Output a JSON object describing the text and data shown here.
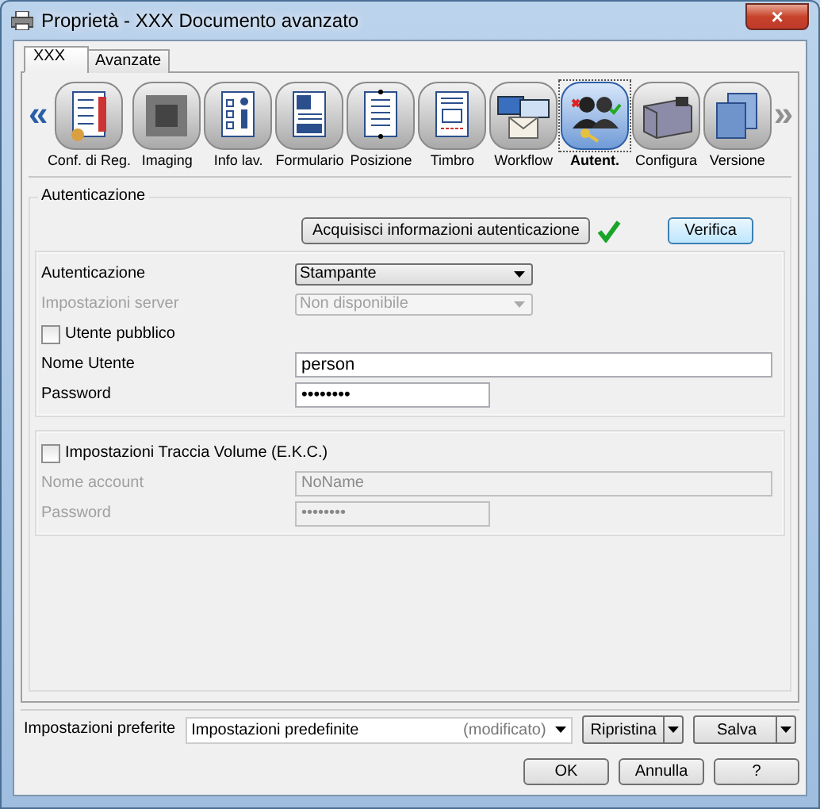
{
  "window": {
    "title": "Proprietà - XXX Documento avanzato",
    "close": "×"
  },
  "tabs": [
    {
      "label": "XXX",
      "selected": true
    },
    {
      "label": "Avanzate",
      "selected": false
    }
  ],
  "scroll_left": {
    "label": "«",
    "disabled": false
  },
  "scroll_right": {
    "label": "»",
    "disabled": true
  },
  "categories": [
    {
      "label": "Conf. di Reg.",
      "kind": "list",
      "selected": false
    },
    {
      "label": "Imaging",
      "kind": "imaging",
      "selected": false
    },
    {
      "label": "Info lav.",
      "kind": "info",
      "selected": false
    },
    {
      "label": "Formulario",
      "kind": "form",
      "selected": false
    },
    {
      "label": "Posizione",
      "kind": "position",
      "selected": false
    },
    {
      "label": "Timbro",
      "kind": "stamp",
      "selected": false
    },
    {
      "label": "Workflow",
      "kind": "workflow",
      "selected": false
    },
    {
      "label": "Autent.",
      "kind": "auth",
      "selected": true
    },
    {
      "label": "Configura",
      "kind": "config",
      "selected": false
    },
    {
      "label": "Versione",
      "kind": "version",
      "selected": false
    }
  ],
  "auth_group": {
    "title": "Autenticazione",
    "fetch_button": "Acquisisci informazioni autenticazione",
    "fetch_ok": true,
    "verify_button": "Verifica",
    "fields": [
      {
        "kind": "select",
        "label": "Autenticazione",
        "value": "Stampante",
        "disabled": false
      },
      {
        "kind": "select",
        "label": "Impostazioni server",
        "value": "Non disponibile",
        "disabled": true
      },
      {
        "kind": "checkbox",
        "label": "Utente pubblico",
        "checked": false
      },
      {
        "kind": "text",
        "label": "Nome Utente",
        "value": "person",
        "disabled": false
      },
      {
        "kind": "password",
        "label": "Password",
        "value": "••••••••",
        "disabled": false
      }
    ],
    "tracking": {
      "label": "Impostazioni Traccia Volume (E.K.C.)",
      "checked": false,
      "fields": [
        {
          "kind": "text",
          "label": "Nome account",
          "value": "NoName",
          "disabled": true
        },
        {
          "kind": "password",
          "label": "Password",
          "value": "••••••••",
          "disabled": true
        }
      ]
    }
  },
  "favorites": {
    "label": "Impostazioni preferite",
    "value": "Impostazioni predefinite",
    "note": "(modificato)",
    "restore_button": "Ripristina",
    "save_button": "Salva"
  },
  "buttons": [
    "OK",
    "Annulla",
    "?"
  ]
}
